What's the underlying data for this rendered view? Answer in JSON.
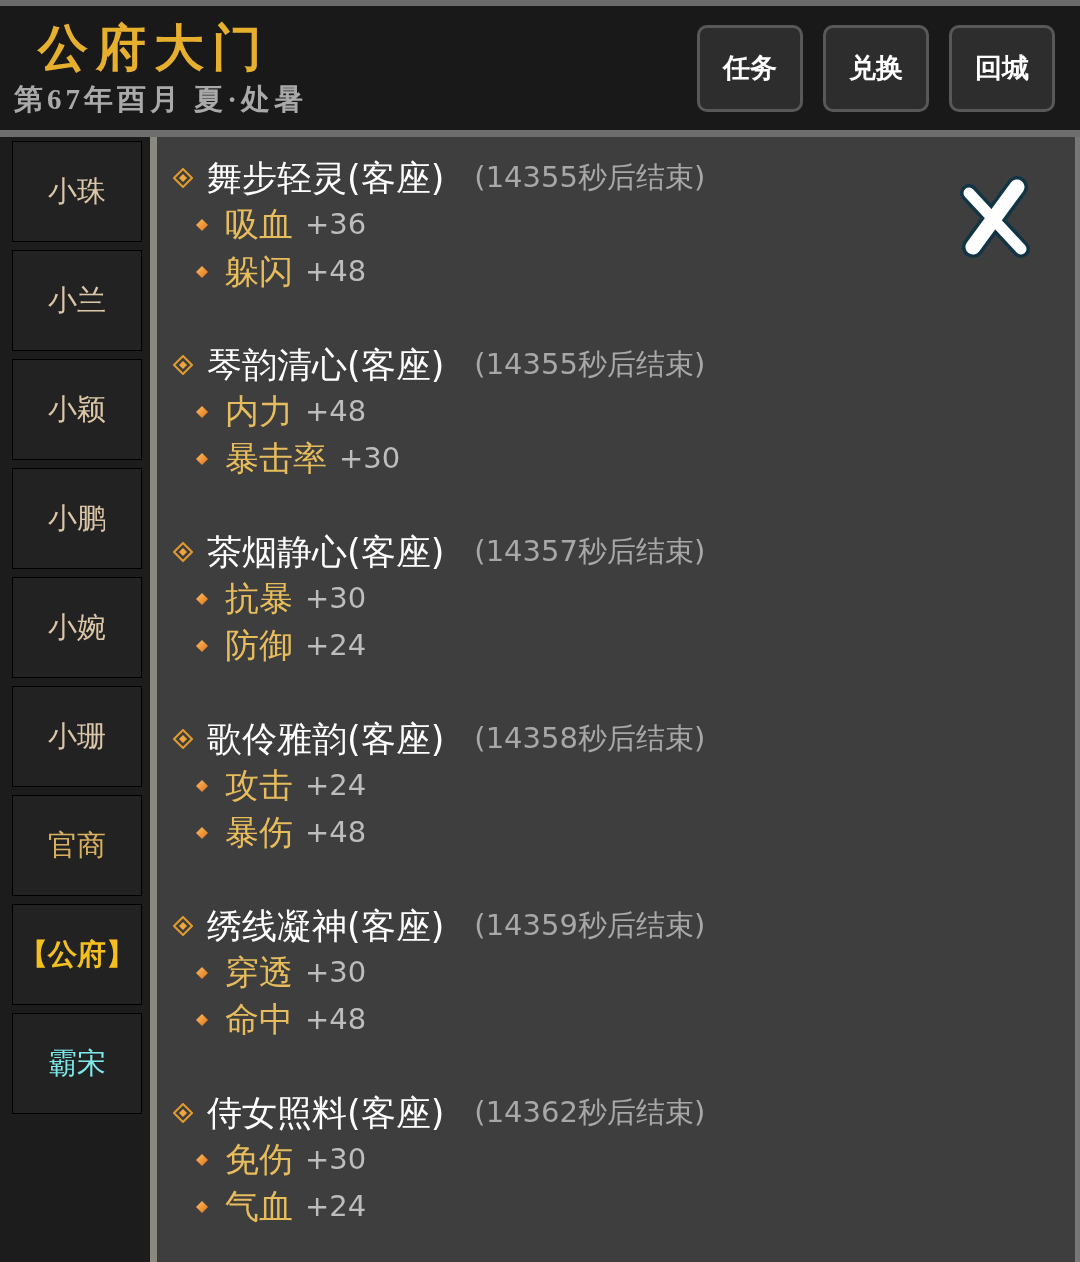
{
  "header": {
    "title": "公府大门",
    "subtitle": "第67年酉月 夏·处暑",
    "buttons": [
      "任务",
      "兑换",
      "回城"
    ]
  },
  "sidebar": {
    "items": [
      {
        "label": "小珠",
        "color": "#dcc6a8",
        "selected": false
      },
      {
        "label": "小兰",
        "color": "#dcc6a8",
        "selected": false
      },
      {
        "label": "小颖",
        "color": "#dcc6a8",
        "selected": false
      },
      {
        "label": "小鹏",
        "color": "#dcc6a8",
        "selected": false
      },
      {
        "label": "小婉",
        "color": "#dcc6a8",
        "selected": false
      },
      {
        "label": "小珊",
        "color": "#dcc6a8",
        "selected": false
      },
      {
        "label": "官商",
        "color": "#d9b060",
        "selected": false
      },
      {
        "label": "【公府】",
        "color": "#f5c01e",
        "selected": true
      },
      {
        "label": "霸宋",
        "color": "#7fe8ea",
        "selected": false
      }
    ]
  },
  "buffs": [
    {
      "name": "舞步轻灵(客座)",
      "timer": "(14355秒后结束)",
      "stats": [
        {
          "name": "吸血",
          "value": "+36"
        },
        {
          "name": "躲闪",
          "value": "+48"
        }
      ]
    },
    {
      "name": "琴韵清心(客座)",
      "timer": "(14355秒后结束)",
      "stats": [
        {
          "name": "内力",
          "value": "+48"
        },
        {
          "name": "暴击率",
          "value": "+30"
        }
      ]
    },
    {
      "name": "茶烟静心(客座)",
      "timer": "(14357秒后结束)",
      "stats": [
        {
          "name": "抗暴",
          "value": "+30"
        },
        {
          "name": "防御",
          "value": "+24"
        }
      ]
    },
    {
      "name": "歌伶雅韵(客座)",
      "timer": "(14358秒后结束)",
      "stats": [
        {
          "name": "攻击",
          "value": "+24"
        },
        {
          "name": "暴伤",
          "value": "+48"
        }
      ]
    },
    {
      "name": "绣线凝神(客座)",
      "timer": "(14359秒后结束)",
      "stats": [
        {
          "name": "穿透",
          "value": "+30"
        },
        {
          "name": "命中",
          "value": "+48"
        }
      ]
    },
    {
      "name": "侍女照料(客座)",
      "timer": "(14362秒后结束)",
      "stats": [
        {
          "name": "免伤",
          "value": "+30"
        },
        {
          "name": "气血",
          "value": "+24"
        }
      ]
    }
  ]
}
